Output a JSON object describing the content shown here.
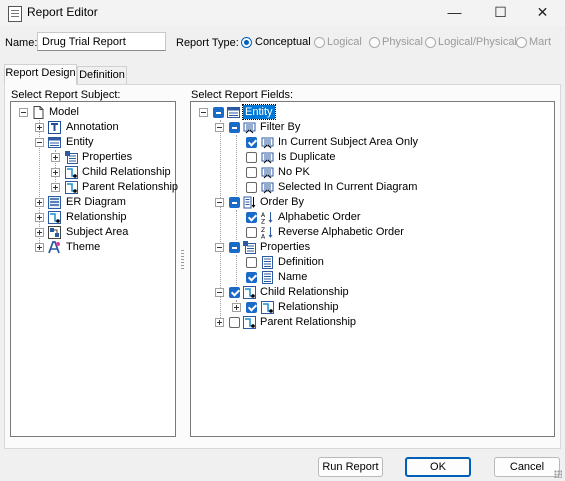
{
  "window": {
    "title": "Report Editor",
    "controls": {
      "minimize": "—",
      "maximize": "☐",
      "close": "✕"
    }
  },
  "form": {
    "name_label": "Name:",
    "name_value": "Drug Trial Report",
    "report_type_label": "Report Type:",
    "report_types": [
      {
        "label": "Conceptual",
        "selected": true,
        "enabled": true
      },
      {
        "label": "Logical",
        "selected": false,
        "enabled": false
      },
      {
        "label": "Physical",
        "selected": false,
        "enabled": false
      },
      {
        "label": "Logical/Physical",
        "selected": false,
        "enabled": false
      },
      {
        "label": "Mart",
        "selected": false,
        "enabled": false
      }
    ]
  },
  "tabs": [
    {
      "label": "Report Design",
      "active": true
    },
    {
      "label": "Definition",
      "active": false
    }
  ],
  "subject_pane": {
    "label": "Select Report Subject:",
    "items": [
      {
        "label": "Model",
        "icon": "document-icon",
        "expander": "minus"
      },
      {
        "label": "Annotation",
        "icon": "text-annotation-icon",
        "expander": "plus"
      },
      {
        "label": "Entity",
        "icon": "entity-table-icon",
        "expander": "minus"
      },
      {
        "label": "Properties",
        "icon": "properties-icon",
        "expander": "plus"
      },
      {
        "label": "Child Relationship",
        "icon": "child-relationship-icon",
        "expander": "plus"
      },
      {
        "label": "Parent Relationship",
        "icon": "parent-relationship-icon",
        "expander": "plus"
      },
      {
        "label": "ER Diagram",
        "icon": "er-diagram-icon",
        "expander": "plus"
      },
      {
        "label": "Relationship",
        "icon": "relationship-icon",
        "expander": "plus"
      },
      {
        "label": "Subject Area",
        "icon": "subject-area-icon",
        "expander": "plus"
      },
      {
        "label": "Theme",
        "icon": "theme-icon",
        "expander": "plus"
      }
    ]
  },
  "fields_pane": {
    "label": "Select Report Fields:",
    "items": [
      {
        "label": "Entity",
        "icon": "entity-table-icon",
        "check": "partial",
        "expander": "minus",
        "selected": true
      },
      {
        "label": "Filter By",
        "icon": "filter-icon",
        "check": "partial",
        "expander": "minus"
      },
      {
        "label": "In Current Subject Area Only",
        "icon": "filter-icon",
        "check": "checked"
      },
      {
        "label": "Is Duplicate",
        "icon": "filter-icon",
        "check": "unchecked"
      },
      {
        "label": "No PK",
        "icon": "filter-icon",
        "check": "unchecked"
      },
      {
        "label": "Selected In Current Diagram",
        "icon": "filter-icon",
        "check": "unchecked"
      },
      {
        "label": "Order By",
        "icon": "order-icon",
        "check": "partial",
        "expander": "minus"
      },
      {
        "label": "Alphabetic Order",
        "icon": "sort-az-icon",
        "check": "checked"
      },
      {
        "label": "Reverse Alphabetic Order",
        "icon": "sort-za-icon",
        "check": "unchecked"
      },
      {
        "label": "Properties",
        "icon": "properties-icon",
        "check": "partial",
        "expander": "minus"
      },
      {
        "label": "Definition",
        "icon": "field-icon",
        "check": "unchecked"
      },
      {
        "label": "Name",
        "icon": "field-icon",
        "check": "checked"
      },
      {
        "label": "Child Relationship",
        "icon": "child-relationship-icon",
        "check": "checked",
        "expander": "minus"
      },
      {
        "label": "Relationship",
        "icon": "relationship-icon",
        "check": "checked",
        "expander": "plus"
      },
      {
        "label": "Parent Relationship",
        "icon": "parent-relationship-icon",
        "check": "unchecked",
        "expander": "plus"
      }
    ]
  },
  "buttons": {
    "run_report": "Run Report",
    "ok": "OK",
    "cancel": "Cancel"
  },
  "colors": {
    "accent": "#005fb8",
    "selection": "#0078d7",
    "dialog_bg": "#f0f0f0"
  }
}
